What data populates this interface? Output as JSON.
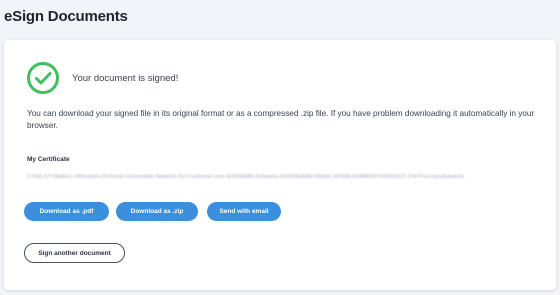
{
  "header": {
    "title": "eSign Documents"
  },
  "status": {
    "icon": "check-circle-icon",
    "message": "Your document is signed!",
    "color": "#3fbf5f"
  },
  "info": {
    "text": "You can download your signed file in its original format or as a compressed .zip file. If you have problem downloading it automatically in your browser."
  },
  "certificate": {
    "label": "My Certificate",
    "value": "C=GB,ST=Wales,L=Wrexham,O=Grosh Universities Network,OU=Customer com,SURNAME=Edwards,GIVENNAME=Welsh,SERIALNUMBER=VHN00137,CN=FranciscaEdwards"
  },
  "actions": {
    "download_pdf": "Download as .pdf",
    "download_zip": "Download as .zip",
    "send_email": "Send with email",
    "sign_another": "Sign another document"
  },
  "colors": {
    "accent": "#3b8fdd",
    "success": "#3fbf5f",
    "background": "#f1f4f8"
  }
}
